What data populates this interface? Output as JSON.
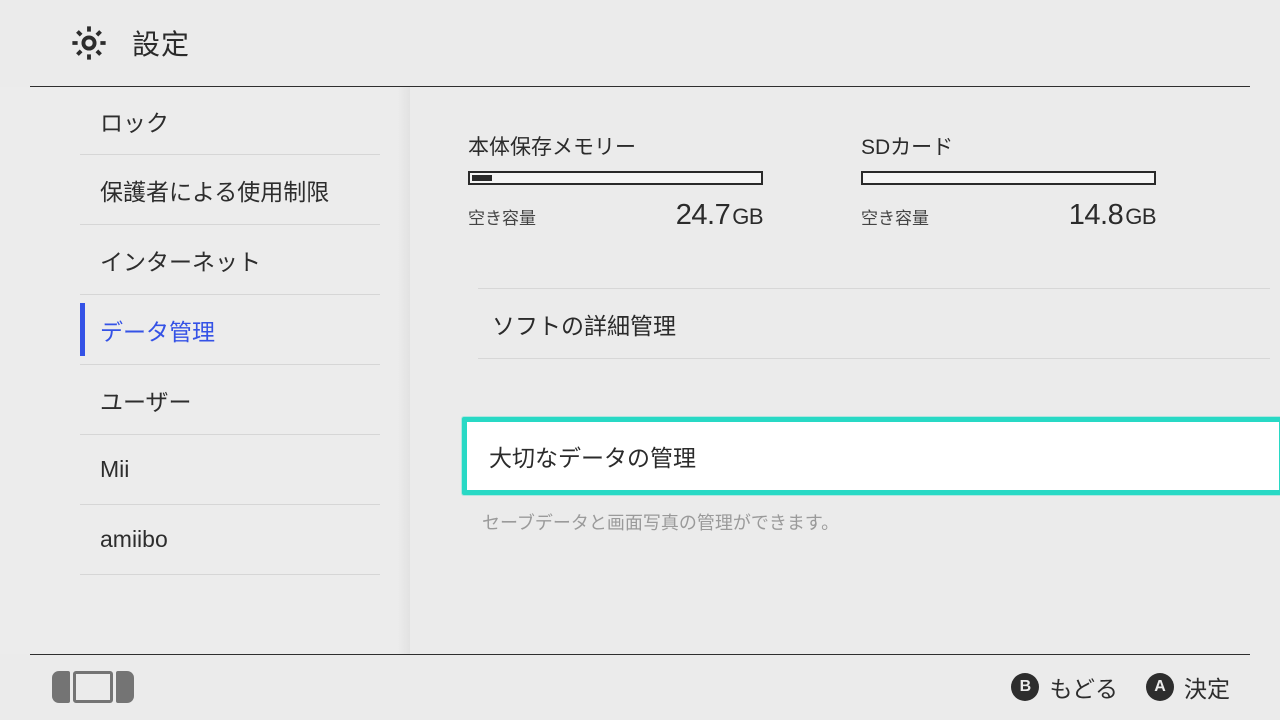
{
  "header": {
    "title": "設定"
  },
  "sidebar": {
    "items": [
      {
        "label": "ロック"
      },
      {
        "label": "保護者による使用制限"
      },
      {
        "label": "インターネット"
      },
      {
        "label": "データ管理"
      },
      {
        "label": "ユーザー"
      },
      {
        "label": "Mii"
      },
      {
        "label": "amiibo"
      }
    ],
    "selected_index": 3
  },
  "storage": {
    "system": {
      "title": "本体保存メモリー",
      "free_label": "空き容量",
      "free_value": "24.7",
      "free_unit": "GB",
      "fill_percent": 7
    },
    "sd": {
      "title": "SDカード",
      "free_label": "空き容量",
      "free_value": "14.8",
      "free_unit": "GB",
      "fill_percent": 0
    }
  },
  "menu": {
    "software_detail": "ソフトの詳細管理",
    "important_data": "大切なデータの管理",
    "important_data_help": "セーブデータと画面写真の管理ができます。"
  },
  "footer": {
    "back_key": "B",
    "back_label": "もどる",
    "ok_key": "A",
    "ok_label": "決定"
  }
}
